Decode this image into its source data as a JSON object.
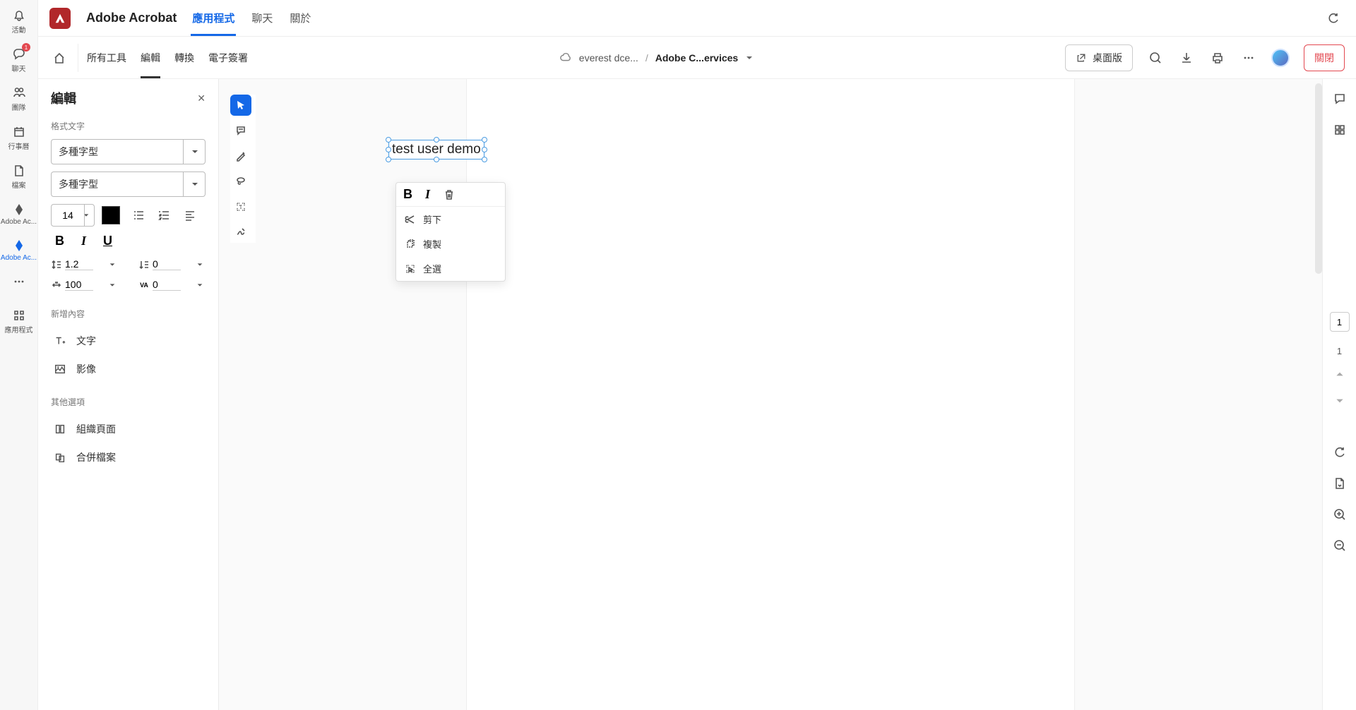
{
  "app_title": "Adobe Acrobat",
  "header_tabs": {
    "apps": "應用程式",
    "chat": "聊天",
    "about": "關於"
  },
  "left_rail": {
    "activity": "活動",
    "chat": "聊天",
    "team": "團隊",
    "calendar": "行事曆",
    "files": "檔案",
    "acrobat1": "Adobe Ac...",
    "acrobat2": "Adobe Ac...",
    "apps": "應用程式",
    "badge": "1"
  },
  "tool_tabs": {
    "all_tools": "所有工具",
    "edit": "編輯",
    "convert": "轉換",
    "esign": "電子簽署"
  },
  "breadcrumb": {
    "location": "everest dce...",
    "sep": "/",
    "doc": "Adobe C...ervices"
  },
  "actions": {
    "desktop": "桌面版",
    "close": "關閉"
  },
  "panel": {
    "title": "編輯",
    "section_format": "格式文字",
    "font_family": "多種字型",
    "font_style": "多種字型",
    "font_size": "14",
    "line_height": "1.2",
    "para_spacing": "0",
    "horiz_scale": "100",
    "tracking": "0",
    "section_add": "新增內容",
    "add_text": "文字",
    "add_image": "影像",
    "section_other": "其他選項",
    "organize": "組織頁面",
    "combine": "合併檔案"
  },
  "canvas": {
    "text": "test user demo"
  },
  "context_menu": {
    "cut": "剪下",
    "copy": "複製",
    "select_all": "全選"
  },
  "page": {
    "current": "1",
    "total": "1"
  }
}
